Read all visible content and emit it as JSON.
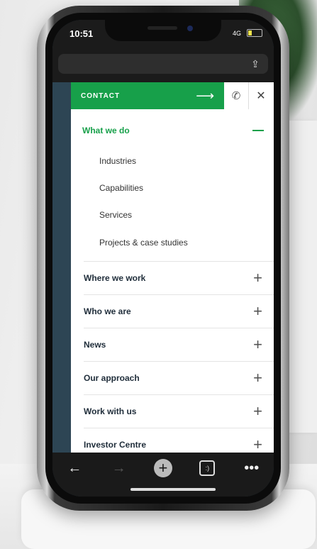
{
  "status": {
    "time": "10:51",
    "network": "4G"
  },
  "contact": {
    "label": "CONTACT"
  },
  "menu": {
    "expanded": {
      "title": "What we do",
      "items": [
        "Industries",
        "Capabilities",
        "Services",
        "Projects & case studies"
      ]
    },
    "items": [
      "Where we work",
      "Who we are",
      "News",
      "Our approach",
      "Work with us",
      "Investor Centre"
    ]
  },
  "icons": {
    "arrow": "arrow-right-icon",
    "phone": "phone-icon",
    "close": "close-icon",
    "share": "share-icon",
    "back": "back-arrow-icon",
    "forward": "forward-arrow-icon",
    "new_tab": "plus-icon",
    "tabs": "tabs-icon",
    "more": "more-icon"
  },
  "colors": {
    "brand_green": "#17a04a",
    "text_dark": "#1f2d3a"
  },
  "toolbar": {
    "tabs_glyph": ":)",
    "more_glyph": "•••"
  }
}
